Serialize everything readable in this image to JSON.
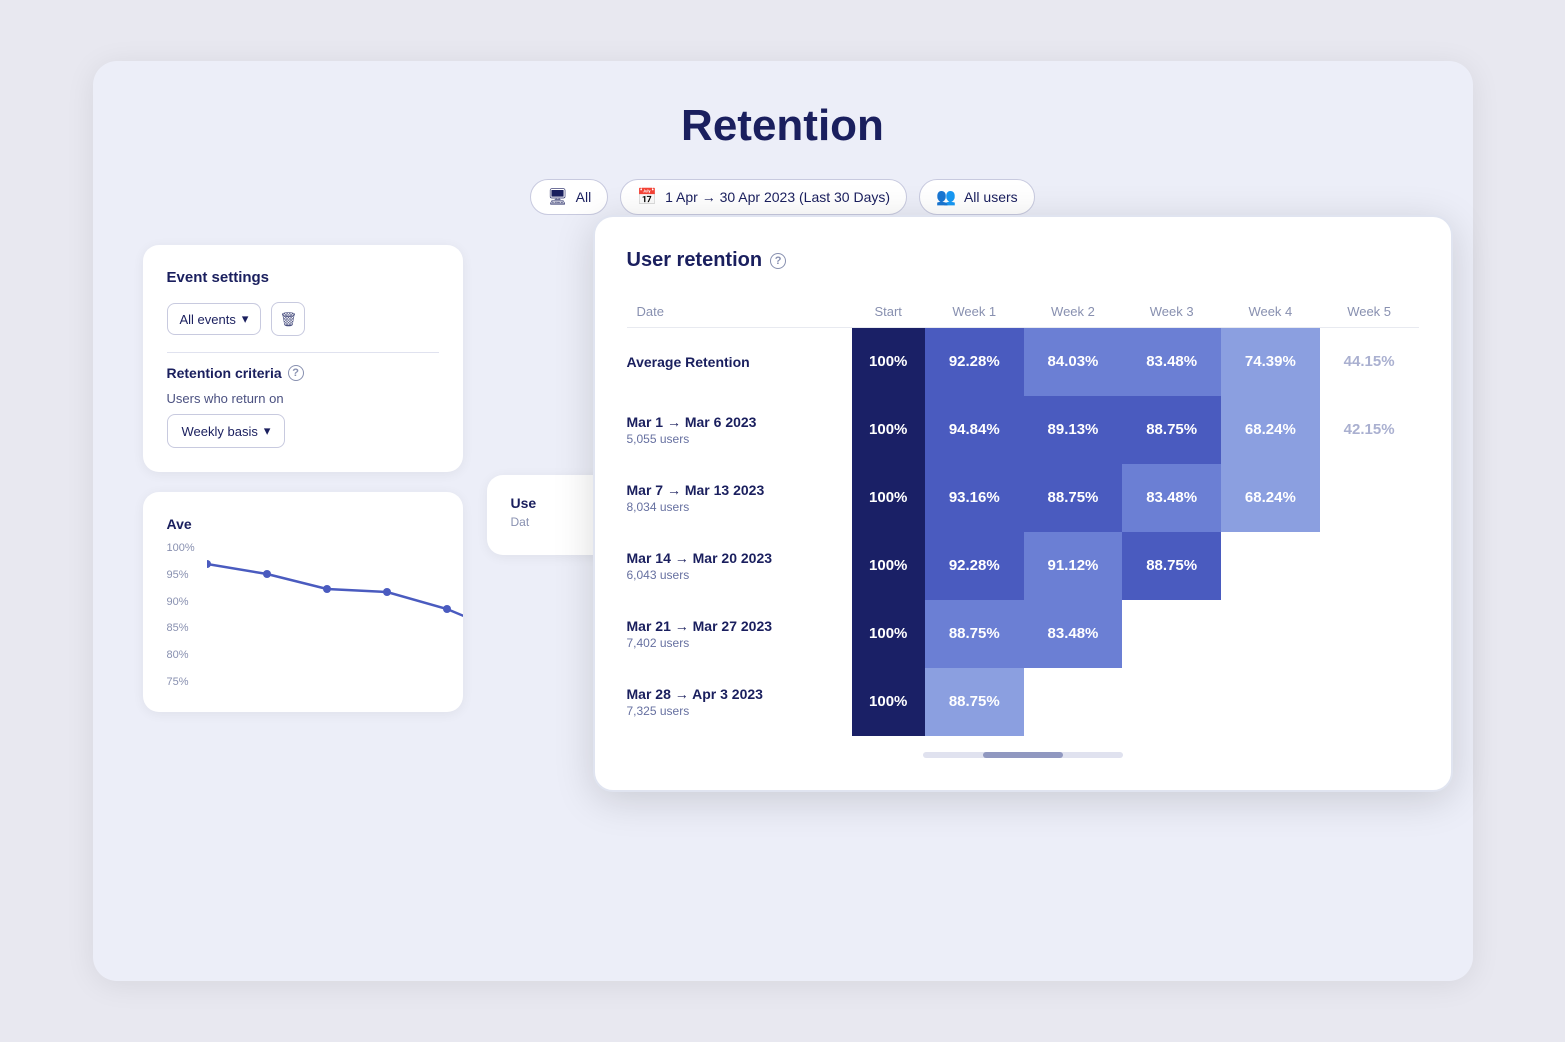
{
  "page": {
    "title": "Retention"
  },
  "filters": [
    {
      "id": "all",
      "icon": "🖥",
      "label": "All"
    },
    {
      "id": "date",
      "icon": "📅",
      "label": "1 Apr → 30 Apr 2023 (Last 30 Days)"
    },
    {
      "id": "users",
      "icon": "👥",
      "label": "All users"
    }
  ],
  "event_settings": {
    "title": "Event settings",
    "dropdown_label": "All events",
    "delete_tooltip": "Delete"
  },
  "retention_criteria": {
    "title": "Retention criteria",
    "sublabel": "Users who return on",
    "dropdown_label": "Weekly basis"
  },
  "user_retention": {
    "title": "User retention",
    "columns": [
      "Date",
      "Start",
      "Week 1",
      "Week 2",
      "Week 3",
      "Week 4",
      "Week 5"
    ],
    "rows": [
      {
        "id": "avg",
        "date": "Average Retention",
        "users": "",
        "values": [
          "100%",
          "92.28%",
          "84.03%",
          "83.48%",
          "74.39%",
          "44.15%"
        ],
        "styles": [
          "dark",
          "blue-1",
          "blue-2",
          "blue-2",
          "blue-3",
          "light"
        ]
      },
      {
        "id": "row1",
        "date": "Mar 1 → Mar 6 2023",
        "users": "5,055 users",
        "values": [
          "100%",
          "94.84%",
          "89.13%",
          "88.75%",
          "68.24%",
          "42.15%"
        ],
        "styles": [
          "dark",
          "blue-1",
          "blue-1",
          "blue-1",
          "blue-3",
          "light"
        ]
      },
      {
        "id": "row2",
        "date": "Mar 7 → Mar 13 2023",
        "users": "8,034 users",
        "values": [
          "100%",
          "93.16%",
          "88.75%",
          "83.48%",
          "68.24%",
          ""
        ],
        "styles": [
          "dark",
          "blue-1",
          "blue-1",
          "blue-2",
          "blue-3",
          "light"
        ]
      },
      {
        "id": "row3",
        "date": "Mar 14 → Mar 20 2023",
        "users": "6,043 users",
        "values": [
          "100%",
          "92.28%",
          "91.12%",
          "88.75%",
          "",
          ""
        ],
        "styles": [
          "dark",
          "blue-1",
          "blue-2",
          "blue-1",
          "light",
          "light"
        ]
      },
      {
        "id": "row4",
        "date": "Mar 21 → Mar 27 2023",
        "users": "7,402 users",
        "values": [
          "100%",
          "88.75%",
          "83.48%",
          "",
          "",
          ""
        ],
        "styles": [
          "dark",
          "blue-2",
          "blue-2",
          "light",
          "light",
          "light"
        ]
      },
      {
        "id": "row5",
        "date": "Mar 28 → Apr 3 2023",
        "users": "7,325 users",
        "values": [
          "100%",
          "88.75%",
          "",
          "",
          "",
          ""
        ],
        "styles": [
          "dark",
          "blue-3",
          "light",
          "light",
          "light",
          "light"
        ]
      }
    ]
  },
  "chart": {
    "title": "Ave",
    "y_labels": [
      "100%",
      "95%",
      "90%",
      "85%",
      "80%",
      "75%"
    ]
  }
}
